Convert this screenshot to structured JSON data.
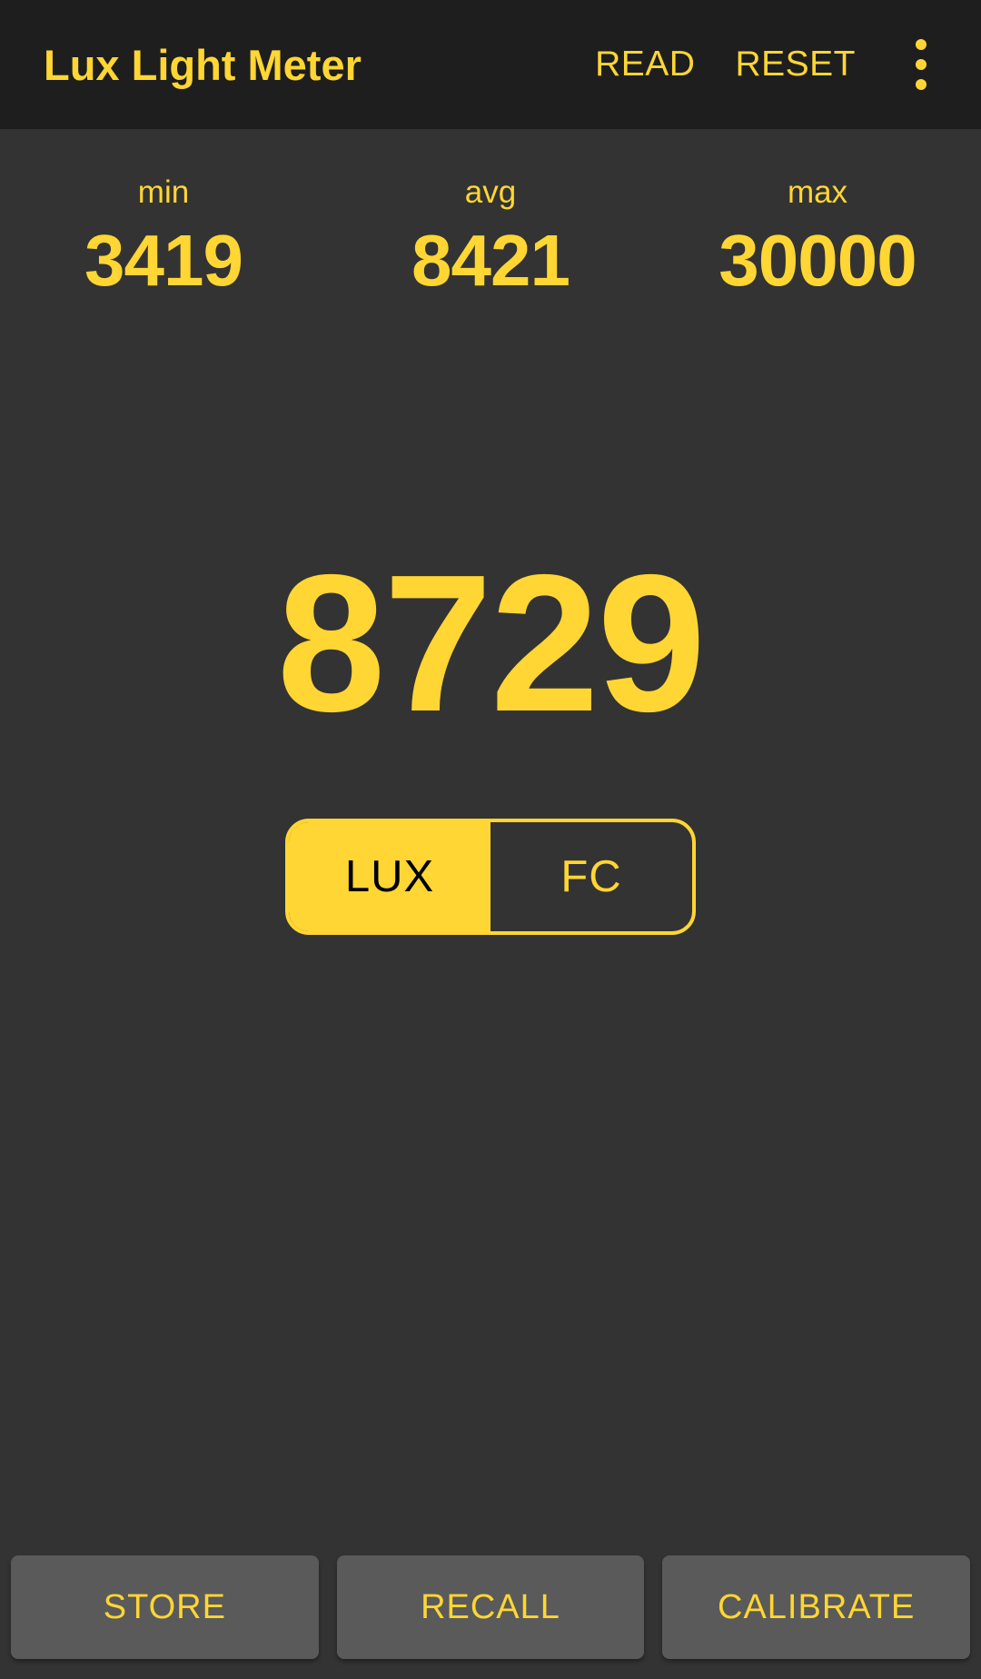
{
  "appbar": {
    "title": "Lux Light Meter",
    "read_label": "READ",
    "reset_label": "RESET",
    "overflow_icon": "more-vert-icon"
  },
  "stats": [
    {
      "label": "min",
      "value": "3419"
    },
    {
      "label": "avg",
      "value": "8421"
    },
    {
      "label": "max",
      "value": "30000"
    }
  ],
  "reading": {
    "value": "8729"
  },
  "unit_toggle": {
    "selected": "LUX",
    "options": [
      {
        "label": "LUX",
        "selected": true
      },
      {
        "label": "FC",
        "selected": false
      }
    ]
  },
  "bottom_actions": [
    {
      "label": "STORE"
    },
    {
      "label": "RECALL"
    },
    {
      "label": "CALIBRATE"
    }
  ],
  "colors": {
    "accent": "#ffd633",
    "appbar_bg": "#1e1e1e",
    "body_bg": "#333333",
    "button_bg": "#5a5a5a",
    "selected_text": "#000000"
  }
}
